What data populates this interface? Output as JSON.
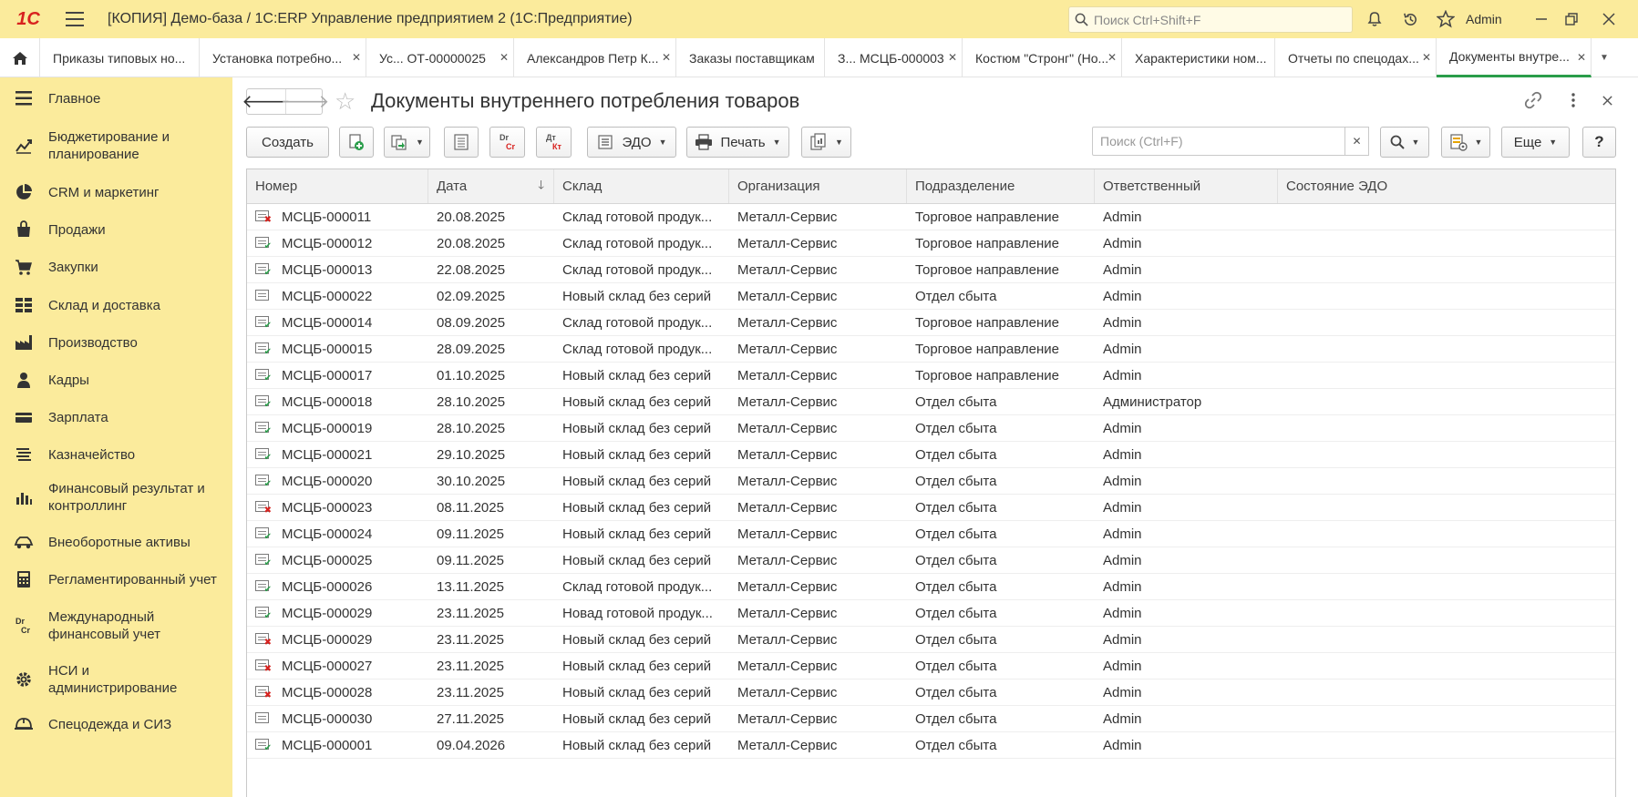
{
  "app": {
    "title": "[КОПИЯ] Демо-база / 1С:ERP Управление предприятием 2  (1С:Предприятие)",
    "logo_text": "1С",
    "search_placeholder": "Поиск Ctrl+Shift+F",
    "user": "Admin"
  },
  "tabs": [
    {
      "label": "Приказы типовых но...",
      "closable": false,
      "active": false
    },
    {
      "label": "Установка потребно...",
      "closable": true,
      "active": false
    },
    {
      "label": "Ус... ОТ-00000025",
      "closable": true,
      "active": false
    },
    {
      "label": "Александров Петр К...",
      "closable": true,
      "active": false
    },
    {
      "label": "Заказы поставщикам",
      "closable": false,
      "active": false
    },
    {
      "label": "З... МСЦБ-000003",
      "closable": true,
      "active": false
    },
    {
      "label": "Костюм \"Стронг\" (Но...",
      "closable": true,
      "active": false
    },
    {
      "label": "Характеристики ном...",
      "closable": false,
      "active": false
    },
    {
      "label": "Отчеты по спецодах...",
      "closable": true,
      "active": false
    },
    {
      "label": "Документы внутре...",
      "closable": true,
      "active": true
    }
  ],
  "sidebar": {
    "items": [
      {
        "label": "Главное",
        "icon": "menu-lines-icon"
      },
      {
        "label": "Бюджетирование и планирование",
        "icon": "budget-chart-icon"
      },
      {
        "label": "CRM и маркетинг",
        "icon": "pie-chart-icon"
      },
      {
        "label": "Продажи",
        "icon": "bag-icon"
      },
      {
        "label": "Закупки",
        "icon": "cart-icon"
      },
      {
        "label": "Склад и доставка",
        "icon": "warehouse-grid-icon"
      },
      {
        "label": "Производство",
        "icon": "factory-icon"
      },
      {
        "label": "Кадры",
        "icon": "person-icon"
      },
      {
        "label": "Зарплата",
        "icon": "wallet-icon"
      },
      {
        "label": "Казначейство",
        "icon": "treasury-icon"
      },
      {
        "label": "Финансовый результат и контроллинг",
        "icon": "bar-chart-icon"
      },
      {
        "label": "Внеоборотные активы",
        "icon": "car-icon"
      },
      {
        "label": "Регламентированный учет",
        "icon": "calculator-icon"
      },
      {
        "label": "Международный финансовый учет",
        "icon": "dr-cr-icon"
      },
      {
        "label": "НСИ и администрирование",
        "icon": "gear-icon"
      },
      {
        "label": "Спецодежда и СИЗ",
        "icon": "helmet-icon"
      }
    ]
  },
  "form": {
    "title": "Документы внутреннего потребления товаров",
    "toolbar": {
      "create": "Создать",
      "edo": "ЭДО",
      "print": "Печать",
      "more": "Еще",
      "help": "?",
      "dr_cr": {
        "top": "Dr",
        "bottom": "Cr"
      },
      "dt_kt": {
        "top": "Дт",
        "bottom": "Кт"
      },
      "search_placeholder": "Поиск (Ctrl+F)"
    }
  },
  "table": {
    "columns": [
      "Номер",
      "Дата",
      "Склад",
      "Организация",
      "Подразделение",
      "Ответственный",
      "Состояние ЭДО"
    ],
    "sort_column": "Дата",
    "sort_direction": "desc",
    "rows": [
      {
        "status": "deleted",
        "number": "МСЦБ-000011",
        "date": "20.08.2025",
        "warehouse": "Склад готовой продук...",
        "org": "Металл-Сервис",
        "dept": "Торговое направление",
        "resp": "Admin",
        "edo": ""
      },
      {
        "status": "posted",
        "number": "МСЦБ-000012",
        "date": "20.08.2025",
        "warehouse": "Склад готовой продук...",
        "org": "Металл-Сервис",
        "dept": "Торговое направление",
        "resp": "Admin",
        "edo": ""
      },
      {
        "status": "posted",
        "number": "МСЦБ-000013",
        "date": "22.08.2025",
        "warehouse": "Склад готовой продук...",
        "org": "Металл-Сервис",
        "dept": "Торговое направление",
        "resp": "Admin",
        "edo": ""
      },
      {
        "status": "draft",
        "number": "МСЦБ-000022",
        "date": "02.09.2025",
        "warehouse": "Новый склад без серий",
        "org": "Металл-Сервис",
        "dept": "Отдел сбыта",
        "resp": "Admin",
        "edo": ""
      },
      {
        "status": "posted",
        "number": "МСЦБ-000014",
        "date": "08.09.2025",
        "warehouse": "Склад готовой продук...",
        "org": "Металл-Сервис",
        "dept": "Торговое направление",
        "resp": "Admin",
        "edo": ""
      },
      {
        "status": "posted",
        "number": "МСЦБ-000015",
        "date": "28.09.2025",
        "warehouse": "Склад готовой продук...",
        "org": "Металл-Сервис",
        "dept": "Торговое направление",
        "resp": "Admin",
        "edo": ""
      },
      {
        "status": "posted",
        "number": "МСЦБ-000017",
        "date": "01.10.2025",
        "warehouse": "Новый склад без серий",
        "org": "Металл-Сервис",
        "dept": "Торговое направление",
        "resp": "Admin",
        "edo": ""
      },
      {
        "status": "posted",
        "number": "МСЦБ-000018",
        "date": "28.10.2025",
        "warehouse": "Новый склад без серий",
        "org": "Металл-Сервис",
        "dept": "Отдел сбыта",
        "resp": "Администратор",
        "edo": ""
      },
      {
        "status": "posted",
        "number": "МСЦБ-000019",
        "date": "28.10.2025",
        "warehouse": "Новый склад без серий",
        "org": "Металл-Сервис",
        "dept": "Отдел сбыта",
        "resp": "Admin",
        "edo": ""
      },
      {
        "status": "posted",
        "number": "МСЦБ-000021",
        "date": "29.10.2025",
        "warehouse": "Новый склад без серий",
        "org": "Металл-Сервис",
        "dept": "Отдел сбыта",
        "resp": "Admin",
        "edo": ""
      },
      {
        "status": "posted",
        "number": "МСЦБ-000020",
        "date": "30.10.2025",
        "warehouse": "Новый склад без серий",
        "org": "Металл-Сервис",
        "dept": "Отдел сбыта",
        "resp": "Admin",
        "edo": ""
      },
      {
        "status": "deleted",
        "number": "МСЦБ-000023",
        "date": "08.11.2025",
        "warehouse": "Новый склад без серий",
        "org": "Металл-Сервис",
        "dept": "Отдел сбыта",
        "resp": "Admin",
        "edo": ""
      },
      {
        "status": "posted",
        "number": "МСЦБ-000024",
        "date": "09.11.2025",
        "warehouse": "Новый склад без серий",
        "org": "Металл-Сервис",
        "dept": "Отдел сбыта",
        "resp": "Admin",
        "edo": ""
      },
      {
        "status": "posted",
        "number": "МСЦБ-000025",
        "date": "09.11.2025",
        "warehouse": "Новый склад без серий",
        "org": "Металл-Сервис",
        "dept": "Отдел сбыта",
        "resp": "Admin",
        "edo": ""
      },
      {
        "status": "posted",
        "number": "МСЦБ-000026",
        "date": "13.11.2025",
        "warehouse": "Склад готовой продук...",
        "org": "Металл-Сервис",
        "dept": "Отдел сбыта",
        "resp": "Admin",
        "edo": ""
      },
      {
        "status": "posted",
        "number": "МСЦБ-000029",
        "date": "23.11.2025",
        "warehouse": "Новад готовой продук...",
        "org": "Металл-Сервис",
        "dept": "Отдел сбыта",
        "resp": "Admin",
        "edo": ""
      },
      {
        "status": "deleted",
        "number": "МСЦБ-000029",
        "date": "23.11.2025",
        "warehouse": "Новый склад без серий",
        "org": "Металл-Сервис",
        "dept": "Отдел сбыта",
        "resp": "Admin",
        "edo": ""
      },
      {
        "status": "deleted",
        "number": "МСЦБ-000027",
        "date": "23.11.2025",
        "warehouse": "Новый склад без серий",
        "org": "Металл-Сервис",
        "dept": "Отдел сбыта",
        "resp": "Admin",
        "edo": ""
      },
      {
        "status": "deleted",
        "number": "МСЦБ-000028",
        "date": "23.11.2025",
        "warehouse": "Новый склад без серий",
        "org": "Металл-Сервис",
        "dept": "Отдел сбыта",
        "resp": "Admin",
        "edo": ""
      },
      {
        "status": "draft",
        "number": "МСЦБ-000030",
        "date": "27.11.2025",
        "warehouse": "Новый склад без серий",
        "org": "Металл-Сервис",
        "dept": "Отдел сбыта",
        "resp": "Admin",
        "edo": ""
      },
      {
        "status": "posted",
        "number": "МСЦБ-000001",
        "date": "09.04.2026",
        "warehouse": "Новый склад без серий",
        "org": "Металл-Сервис",
        "dept": "Отдел сбыта",
        "resp": "Admin",
        "edo": ""
      }
    ]
  },
  "colors": {
    "sidebar_bg": "#fbeb9c",
    "accent_green": "#2a9d4a",
    "deleted_red": "#d8221f"
  }
}
